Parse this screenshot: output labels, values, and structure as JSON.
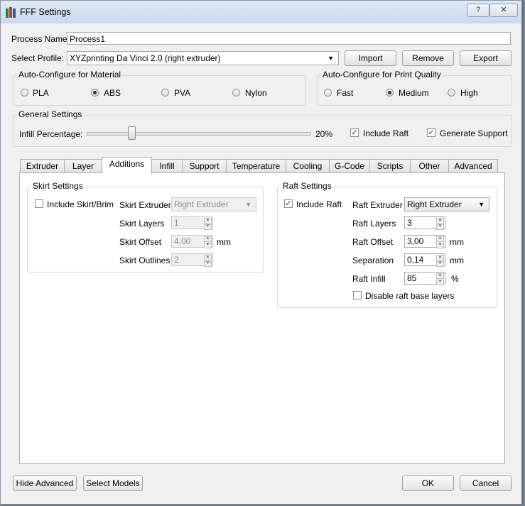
{
  "window": {
    "title": "FFF Settings",
    "help_label": "?",
    "close_label": "✕"
  },
  "process": {
    "name_label": "Process Name:",
    "name_value": "Process1"
  },
  "profile": {
    "label": "Select Profile:",
    "value": "XYZprinting Da Vinci 2.0 (right extruder)",
    "import_label": "Import",
    "remove_label": "Remove",
    "export_label": "Export"
  },
  "material": {
    "title": "Auto-Configure for Material",
    "options": [
      "PLA",
      "ABS",
      "PVA",
      "Nylon"
    ],
    "selected": "ABS"
  },
  "quality": {
    "title": "Auto-Configure for Print Quality",
    "options": [
      "Fast",
      "Medium",
      "High"
    ],
    "selected": "Medium"
  },
  "general": {
    "title": "General Settings",
    "infill_label": "Infill Percentage:",
    "infill_value": "20%",
    "infill_fraction": 0.2,
    "include_raft_label": "Include Raft",
    "include_raft_checked": true,
    "generate_support_label": "Generate Support",
    "generate_support_checked": true
  },
  "tabs": [
    "Extruder",
    "Layer",
    "Additions",
    "Infill",
    "Support",
    "Temperature",
    "Cooling",
    "G-Code",
    "Scripts",
    "Other",
    "Advanced"
  ],
  "active_tab": "Additions",
  "skirt": {
    "title": "Skirt Settings",
    "include_label": "Include Skirt/Brim",
    "include_checked": false,
    "extruder_label": "Skirt Extruder",
    "extruder_value": "Right Extruder",
    "layers_label": "Skirt Layers",
    "layers_value": "1",
    "offset_label": "Skirt Offset",
    "offset_value": "4,00",
    "offset_unit": "mm",
    "outlines_label": "Skirt Outlines",
    "outlines_value": "2"
  },
  "raft": {
    "title": "Raft Settings",
    "include_label": "Include Raft",
    "include_checked": true,
    "extruder_label": "Raft Extruder",
    "extruder_value": "Right Extruder",
    "layers_label": "Raft Layers",
    "layers_value": "3",
    "offset_label": "Raft Offset",
    "offset_value": "3,00",
    "offset_unit": "mm",
    "separation_label": "Separation",
    "separation_value": "0,14",
    "separation_unit": "mm",
    "infill_label": "Raft Infill",
    "infill_value": "85",
    "infill_unit": "%",
    "disable_base_label": "Disable raft base layers",
    "disable_base_checked": false
  },
  "footer": {
    "hide_advanced_label": "Hide Advanced",
    "select_models_label": "Select Models",
    "ok_label": "OK",
    "cancel_label": "Cancel"
  }
}
